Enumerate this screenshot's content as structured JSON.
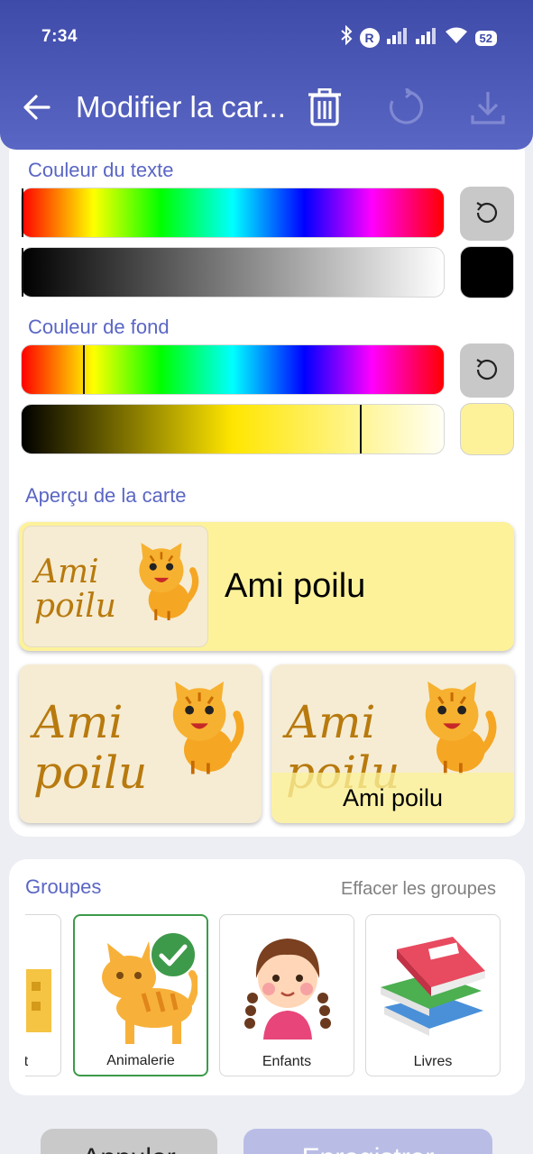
{
  "status_bar": {
    "time": "7:34",
    "battery": "52"
  },
  "header": {
    "title": "Modifier la car...",
    "icons": [
      "back-arrow-icon",
      "trash-icon",
      "refresh-icon",
      "download-icon"
    ]
  },
  "text_color": {
    "label": "Couleur du texte",
    "hue_position": 0.0,
    "shade_position": 0.0,
    "swatch_color": "#000000"
  },
  "background_color": {
    "label": "Couleur de fond",
    "hue_position": 0.146,
    "shade_position": 0.8,
    "swatch_color": "#fdf29a"
  },
  "preview": {
    "label": "Aperçu de la carte",
    "card_name": "Ami poilu",
    "sticker_text_line1": "Ami",
    "sticker_text_line2": "poilu",
    "card_bg": "#fdf29a"
  },
  "groups": {
    "label": "Groupes",
    "clear_label": "Effacer les groupes",
    "items": [
      {
        "name": "ent",
        "selected": false
      },
      {
        "name": "Animalerie",
        "selected": true
      },
      {
        "name": "Enfants",
        "selected": false
      },
      {
        "name": "Livres",
        "selected": false
      }
    ]
  },
  "buttons": {
    "cancel": "Annuler",
    "save": "Enregistrer"
  },
  "colors": {
    "accent": "#5a66c4",
    "selected_border": "#3d9a4a"
  }
}
